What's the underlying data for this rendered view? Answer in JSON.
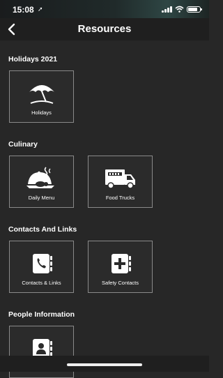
{
  "status_bar": {
    "time": "15:08",
    "location_glyph": "➚"
  },
  "header": {
    "title": "Resources"
  },
  "sections": [
    {
      "title": "Holidays 2021",
      "items": [
        {
          "label": "Holidays",
          "icon": "umbrella-icon"
        }
      ]
    },
    {
      "title": "Culinary",
      "items": [
        {
          "label": "Daily Menu",
          "icon": "dish-icon"
        },
        {
          "label": "Food Trucks",
          "icon": "food-truck-icon"
        }
      ]
    },
    {
      "title": "Contacts And Links",
      "items": [
        {
          "label": "Contacts & Links",
          "icon": "phone-book-icon"
        },
        {
          "label": "Safety Contacts",
          "icon": "medical-book-icon"
        }
      ]
    },
    {
      "title": "People Information",
      "items": [
        {
          "label": "",
          "icon": "contact-book-icon"
        }
      ]
    }
  ],
  "colors": {
    "background": "#272727",
    "header": "#1f1f1f",
    "tile_border": "#8a8a8a",
    "text": "#ffffff"
  }
}
